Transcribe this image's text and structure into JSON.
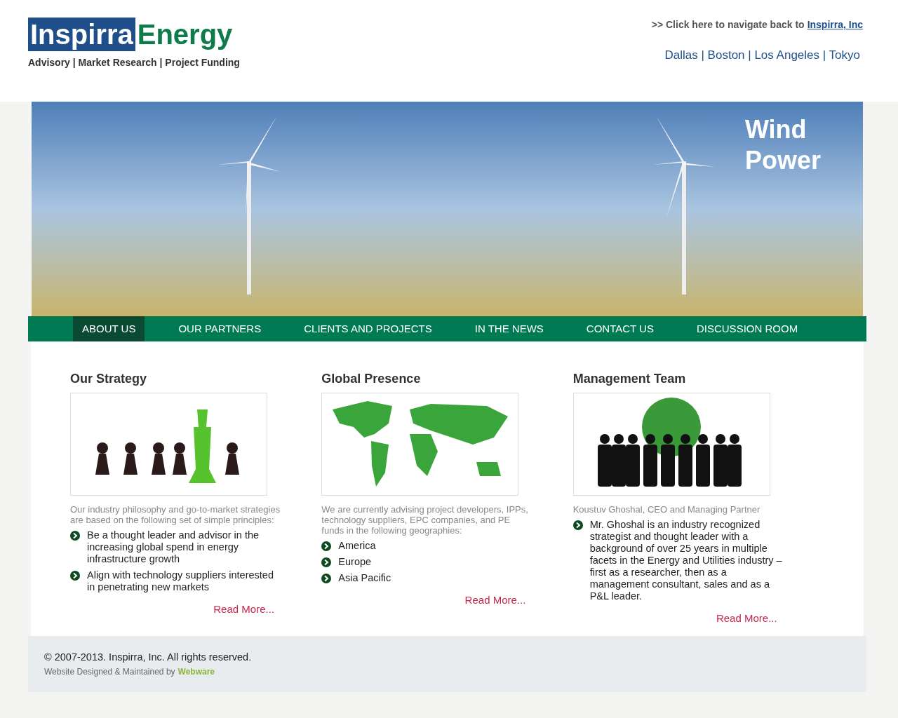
{
  "header": {
    "logo": {
      "part_1": "Inspirra",
      "part_2": "Energy"
    },
    "tagline": "Advisory | Market Research | Project Funding",
    "back_link": {
      "prefix": ">> Click here to navigate back to",
      "link": "Inspirra, Inc"
    },
    "offices": "Dallas | Boston | Los Angeles | Tokyo"
  },
  "banner": {
    "caption_lines": [
      "Wind",
      "Power"
    ]
  },
  "nav": [
    {
      "label": "ABOUT US",
      "selected": true
    },
    {
      "label": "OUR PARTNERS",
      "selected": false
    },
    {
      "label": "CLIENTS AND PROJECTS",
      "selected": false
    },
    {
      "label": "IN THE NEWS",
      "selected": false
    },
    {
      "label": "CONTACT US",
      "selected": false
    },
    {
      "label": "DISCUSSION ROOM",
      "selected": false
    }
  ],
  "columns": [
    {
      "kind": "chess",
      "title": "Our Strategy",
      "intro": "Our industry philosophy and go-to-market strategies are based on the following set of simple principles:",
      "bullets": [
        "Be a thought leader and advisor in the increasing global spend in energy infrastructure growth",
        "Align with technology suppliers interested in penetrating new markets"
      ],
      "read_more": "Read More..."
    },
    {
      "kind": "map",
      "title": "Global Presence",
      "intro": "We are currently advising project developers, IPPs, technology suppliers, EPC companies, and PE funds in the following geographies:",
      "bullets": [
        "America",
        "Europe",
        "Asia Pacific"
      ],
      "read_more": "Read More..."
    },
    {
      "kind": "team",
      "title": "Management Team",
      "intro": "Koustuv Ghoshal, CEO and Managing Partner",
      "bullets": [
        "Mr. Ghoshal is an industry recognized strategist and thought leader with a background of over 25 years in multiple facets in the Energy and Utilities industry – first as a researcher, then as a management consultant, sales and as a P&L leader."
      ],
      "read_more": "Read More..."
    }
  ],
  "footer": {
    "copyright": "© 2007-2013. Inspirra, Inc. All rights reserved.",
    "credit": {
      "prefix": "Website Designed & Maintained by",
      "link": "Webware"
    }
  }
}
